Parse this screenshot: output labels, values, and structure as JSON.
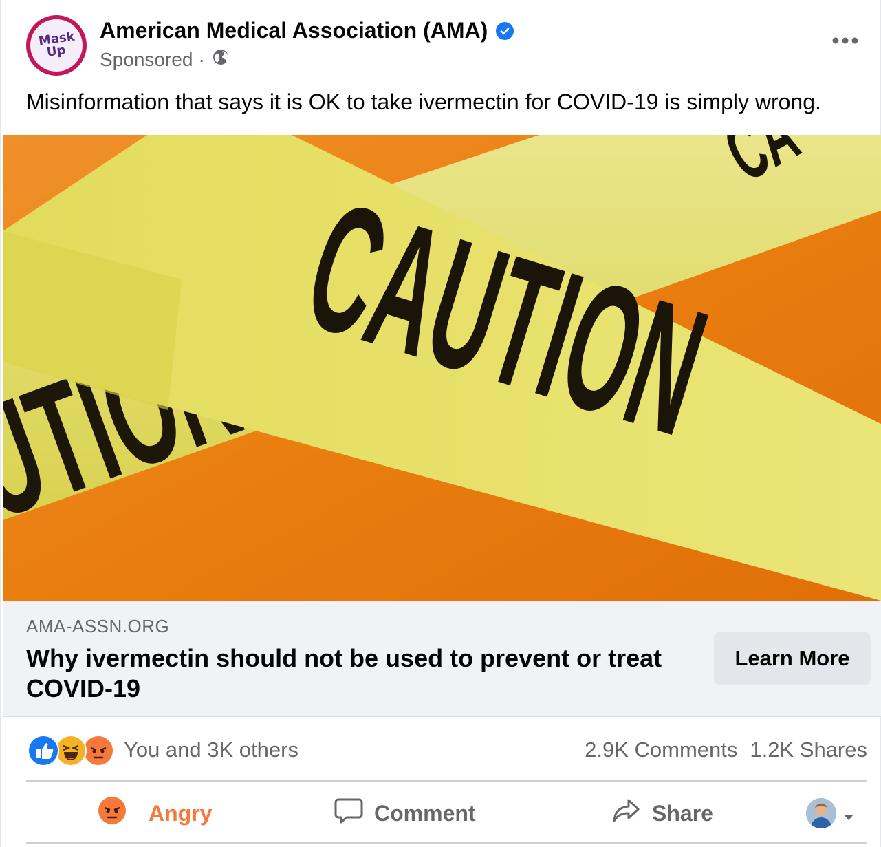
{
  "post": {
    "page_name": "American Medical Association (AMA)",
    "sponsored_label": "Sponsored",
    "separator": "·",
    "avatar_text_line1": "Mask",
    "avatar_text_line2": "Up",
    "caption": "Misinformation that says it is OK to take ivermectin for COVID-19 is simply wrong.",
    "image_tape_text": "CAUTION",
    "image_tape_text_back": "UTION",
    "image_tape_text_top": "CA"
  },
  "link_preview": {
    "domain": "AMA-ASSN.ORG",
    "title": "Why ivermectin should not be used to prevent or treat COVID-19",
    "cta_label": "Learn More"
  },
  "engagement": {
    "reacted_label": "You and 3K others",
    "comments": "2.9K Comments",
    "shares": "1.2K Shares"
  },
  "actions": {
    "react_label": "Angry",
    "comment_label": "Comment",
    "share_label": "Share"
  },
  "colors": {
    "brand_blue": "#1877f2",
    "angry_orange": "#f5793b",
    "tape_yellow": "#e6e060",
    "background_orange": "#e8780f"
  }
}
